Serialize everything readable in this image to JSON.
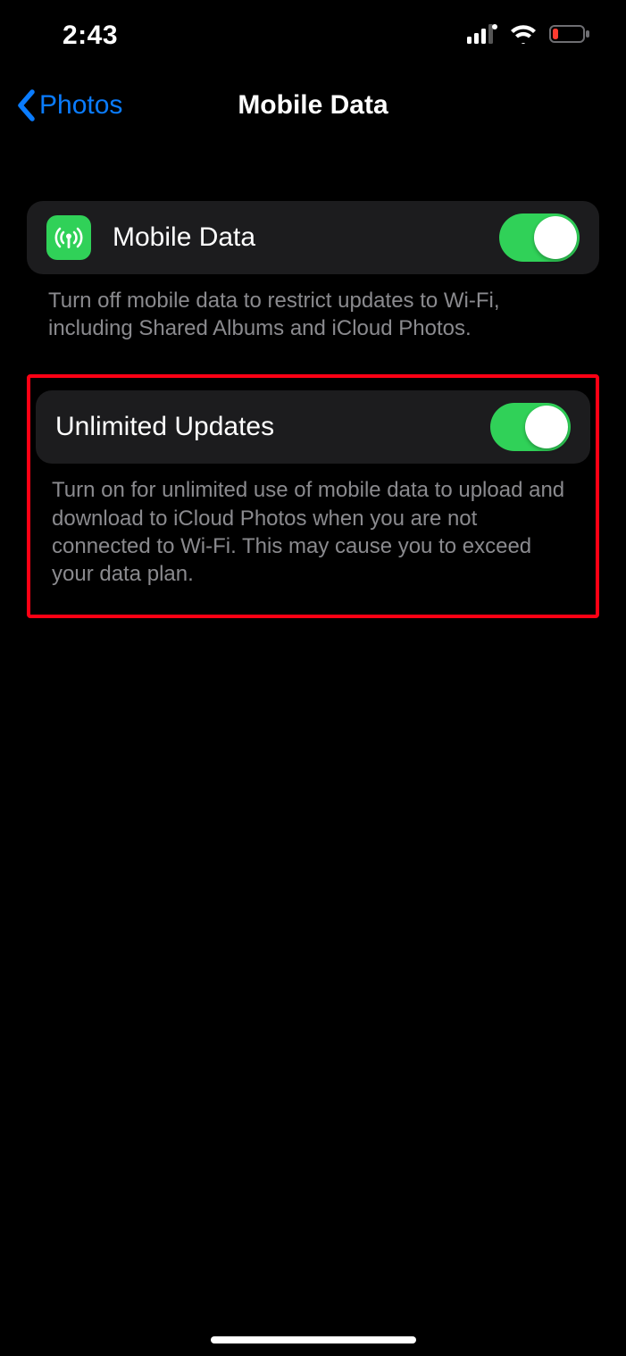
{
  "status": {
    "time": "2:43"
  },
  "nav": {
    "back_label": "Photos",
    "title": "Mobile Data"
  },
  "sections": {
    "mobile_data": {
      "label": "Mobile Data",
      "footer": "Turn off mobile data to restrict updates to Wi-Fi, including Shared Albums and iCloud Photos."
    },
    "unlimited": {
      "label": "Unlimited Updates",
      "footer": "Turn on for unlimited use of mobile data to upload and download to iCloud Photos when you are not connected to Wi-Fi. This may cause you to exceed your data plan."
    }
  }
}
